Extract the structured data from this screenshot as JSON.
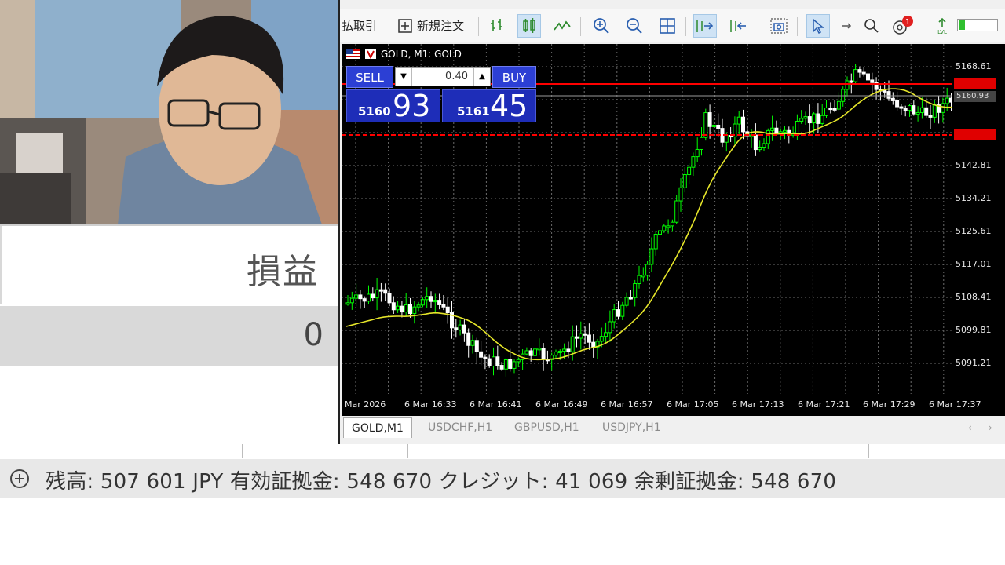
{
  "toolbar": {
    "partial_label": "払取引",
    "new_order_label": "新規注文",
    "notification_count": "1"
  },
  "chart": {
    "title": "GOLD, M1: GOLD",
    "sell_label": "SELL",
    "buy_label": "BUY",
    "volume": "0.40",
    "sell_price_prefix": "5160",
    "sell_price_main": "93",
    "buy_price_prefix": "5161",
    "buy_price_main": "45",
    "price_labels": [
      "5168.61",
      "5142.81",
      "5134.21",
      "5125.61",
      "5117.01",
      "5108.41",
      "5099.81",
      "5091.21"
    ],
    "bid_tag": "5160.93",
    "time_labels": [
      "Mar 2026",
      "6 Mar 16:33",
      "6 Mar 16:41",
      "6 Mar 16:49",
      "6 Mar 16:57",
      "6 Mar 17:05",
      "6 Mar 17:13",
      "6 Mar 17:21",
      "6 Mar 17:29",
      "6 Mar 17:37"
    ],
    "colors": {
      "bull": "#00ff00",
      "bear": "#ffffff",
      "ma": "#e6e62a",
      "level": "#ff0000",
      "grid": "#6b6b6b"
    }
  },
  "tabs": [
    "GOLD,M1",
    "USDCHF,H1",
    "GBPUSD,H1",
    "USDJPY,H1"
  ],
  "left_panel": {
    "header": "損益",
    "value": "0"
  },
  "status": {
    "text": "残高: 507 601 JPY  有効証拠金: 548 670  クレジット: 41 069  余剰証拠金: 548 670"
  }
}
